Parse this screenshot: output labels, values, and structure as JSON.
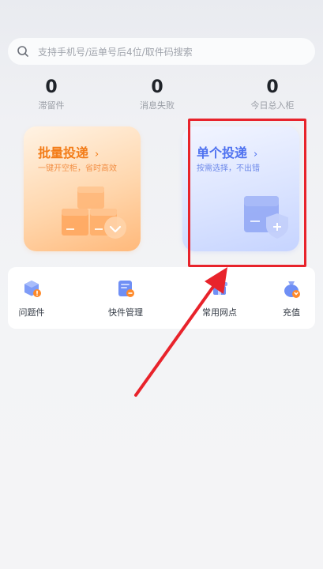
{
  "search": {
    "placeholder": "支持手机号/运单号后4位/取件码搜索",
    "icon": "search-icon"
  },
  "stats": [
    {
      "value": "0",
      "label": "滞留件"
    },
    {
      "value": "0",
      "label": "消息失败"
    },
    {
      "value": "0",
      "label": "今日总入柜"
    }
  ],
  "cards": {
    "batch": {
      "title": "批量投递",
      "subtitle": "一键开空柜，省时高效",
      "chevron": "›"
    },
    "single": {
      "title": "单个投递",
      "subtitle": "按需选择，不出错",
      "chevron": "›"
    }
  },
  "quick_actions": [
    {
      "label": "问题件",
      "icon": "problem-package-icon"
    },
    {
      "label": "快件管理",
      "icon": "package-management-icon"
    },
    {
      "label": "常用网点",
      "icon": "common-outlet-icon"
    },
    {
      "label": "充值",
      "icon": "recharge-icon"
    }
  ],
  "annotation": {
    "highlight_color": "#e8232b"
  }
}
